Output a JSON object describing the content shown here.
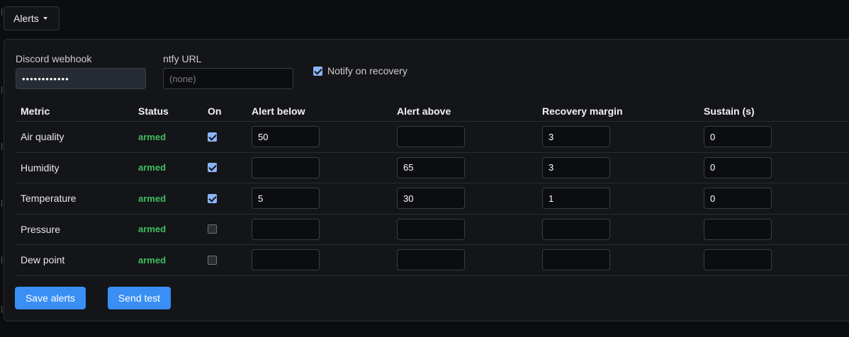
{
  "toggle": {
    "label": "Alerts"
  },
  "webhook": {
    "label": "Discord webhook",
    "value": "••••••••••••"
  },
  "ntfy": {
    "label": "ntfy URL",
    "placeholder": "(none)"
  },
  "recovery": {
    "label": "Notify on recovery",
    "checked": true
  },
  "table": {
    "headers": {
      "metric": "Metric",
      "status": "Status",
      "on": "On",
      "below": "Alert below",
      "above": "Alert above",
      "margin": "Recovery margin",
      "sustain": "Sustain (s)"
    },
    "rows": [
      {
        "metric": "Air quality",
        "status": "armed",
        "on": true,
        "below": "50",
        "above": "",
        "margin": "3",
        "sustain": "0"
      },
      {
        "metric": "Humidity",
        "status": "armed",
        "on": true,
        "below": "",
        "above": "65",
        "margin": "3",
        "sustain": "0"
      },
      {
        "metric": "Temperature",
        "status": "armed",
        "on": true,
        "below": "5",
        "above": "30",
        "margin": "1",
        "sustain": "0"
      },
      {
        "metric": "Pressure",
        "status": "armed",
        "on": false,
        "below": "",
        "above": "",
        "margin": "",
        "sustain": ""
      },
      {
        "metric": "Dew point",
        "status": "armed",
        "on": false,
        "below": "",
        "above": "",
        "margin": "",
        "sustain": ""
      }
    ]
  },
  "buttons": {
    "save": "Save alerts",
    "test": "Send test"
  },
  "colors": {
    "accent": "#3a8ff4",
    "armed": "#3fbf5f",
    "checkbox": "#8ab4f8"
  }
}
